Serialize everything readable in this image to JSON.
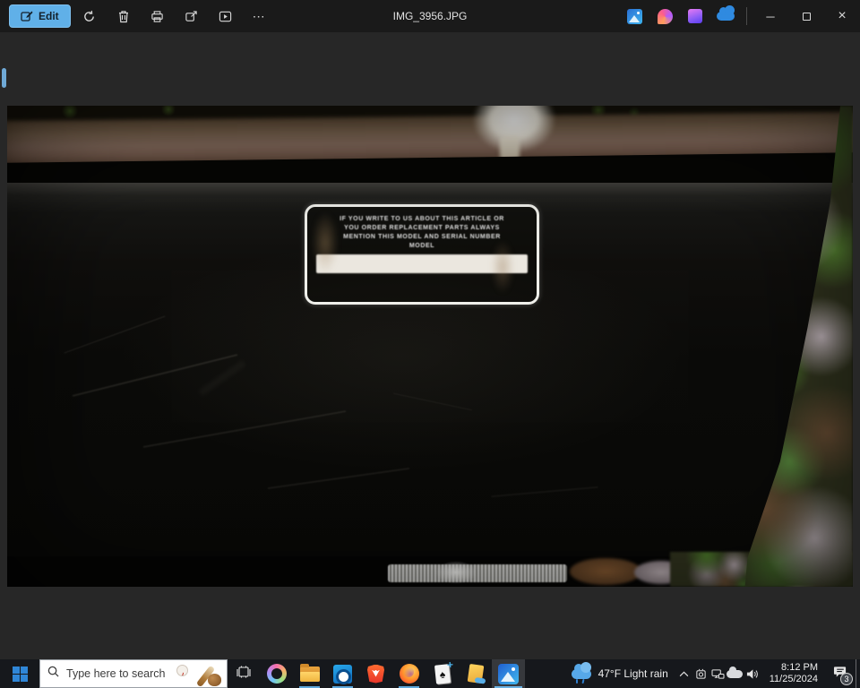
{
  "titlebar": {
    "title": "IMG_3956.JPG",
    "edit_label": "Edit",
    "more_glyph": "⋯",
    "minimize_glyph": "─",
    "close_glyph": "×",
    "app_icons": [
      "photos",
      "designer",
      "clipchamp",
      "onedrive"
    ]
  },
  "photo": {
    "label": {
      "line1": "IF YOU WRITE TO US ABOUT THIS ARTICLE OR",
      "line2": "YOU ORDER REPLACEMENT PARTS ALWAYS",
      "line3": "MENTION THIS MODEL AND SERIAL NUMBER",
      "line4": "MODEL"
    }
  },
  "taskbar": {
    "search_placeholder": "Type here to search",
    "apps": [
      "Task View",
      "Copilot",
      "File Explorer",
      "Outlook",
      "Brave",
      "Firefox",
      "Solitaire",
      "Notes",
      "Photos"
    ],
    "spade_glyph": "♠",
    "weather": {
      "temp": "47°F",
      "condition": "Light rain",
      "combined": "47°F  Light rain"
    },
    "clock": {
      "time": "8:12 PM",
      "date": "11/25/2024"
    },
    "notification_count": "3"
  },
  "colors": {
    "accent_blue": "#60b0e8",
    "titlebar_bg": "#1a1a1a",
    "content_bg": "#272727",
    "taskbar_bg": "#16181c",
    "running_indicator": "#5fa8dc"
  }
}
